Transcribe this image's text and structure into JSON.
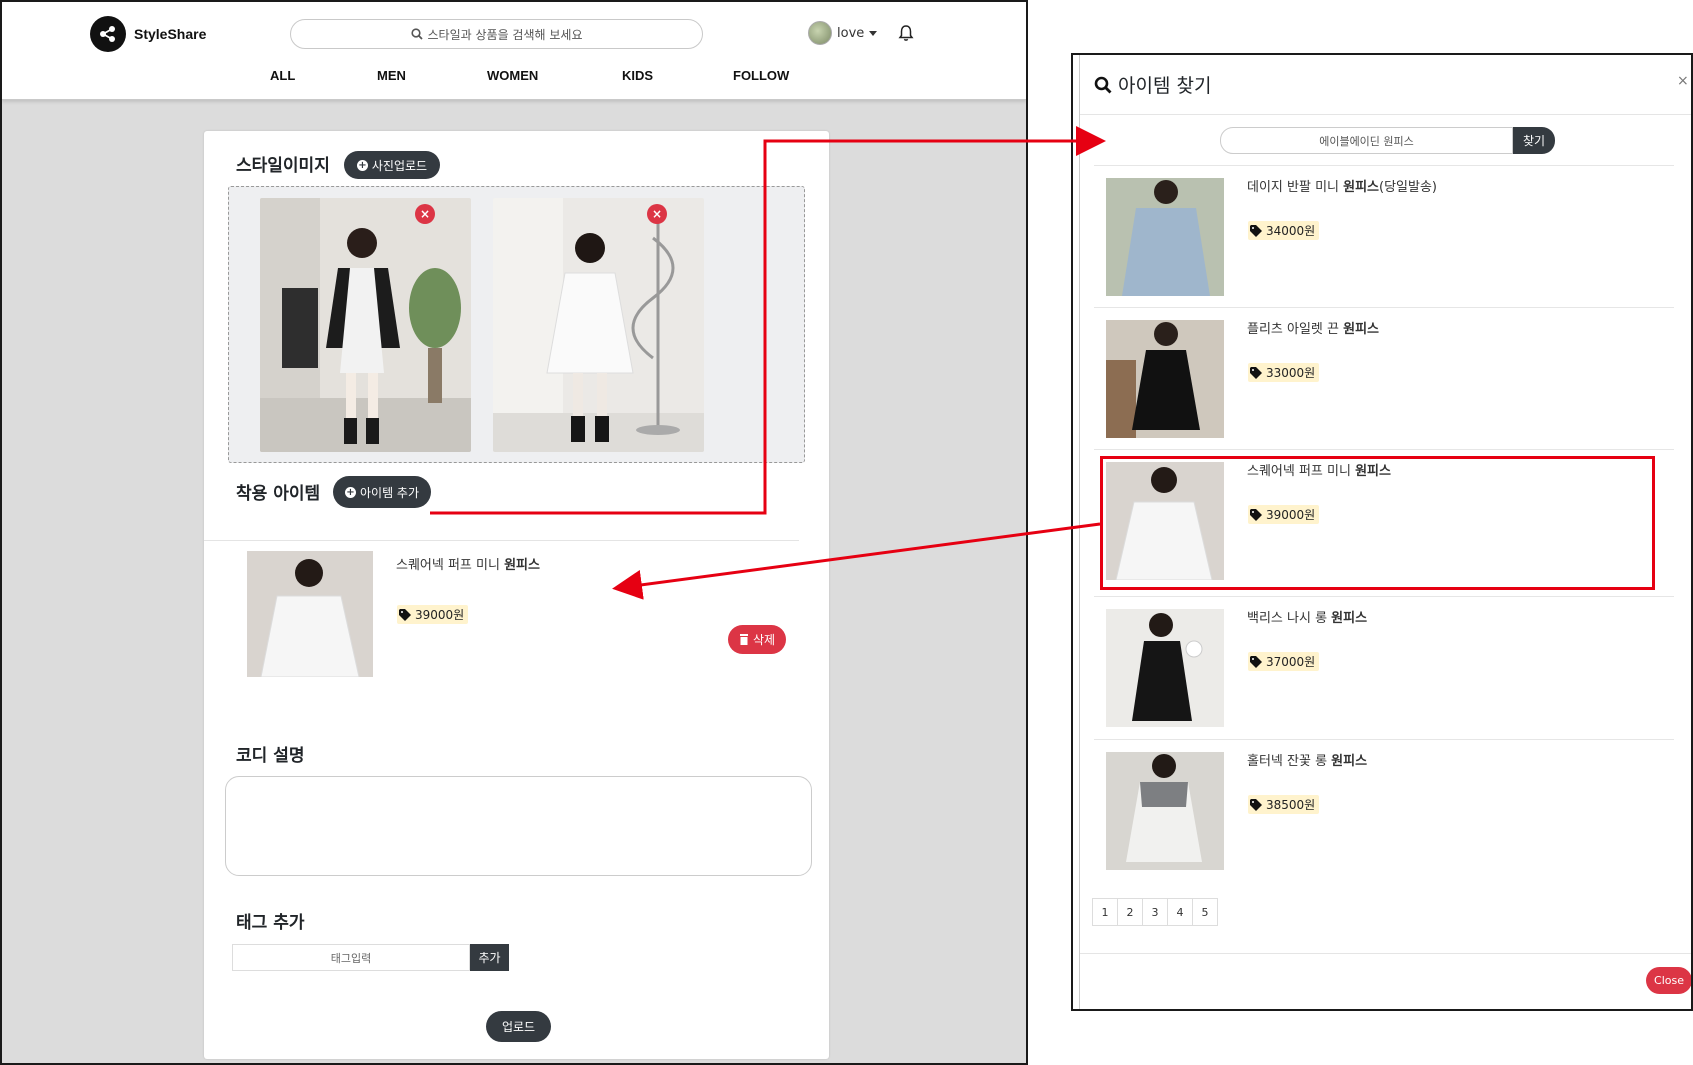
{
  "brand": {
    "name": "StyleShare",
    "logo_icon": "share-icon"
  },
  "search": {
    "placeholder": "스타일과 상품을 검색해 보세요",
    "icon": "search-icon"
  },
  "user": {
    "name": "love"
  },
  "nav": {
    "items": [
      "ALL",
      "MEN",
      "WOMEN",
      "KIDS",
      "FOLLOW"
    ]
  },
  "form": {
    "style_image": {
      "title": "스타일이미지",
      "upload_button": "사진업로드"
    },
    "worn_items": {
      "title": "착용 아이템",
      "add_button": "아이템 추가",
      "item": {
        "name_prefix": "스퀘어넥 퍼프 미니 ",
        "name_bold": "원피스",
        "price": "39000원"
      },
      "delete_button": "삭제"
    },
    "description": {
      "title": "코디 설명"
    },
    "tags": {
      "title": "태그 추가",
      "placeholder": "태그입력",
      "add_button": "추가"
    },
    "upload_button": "업로드"
  },
  "modal": {
    "title": "아이템 찾기",
    "search_value": "에이블에이딘 원피스",
    "search_button": "찾기",
    "close_button": "Close",
    "results": [
      {
        "name_prefix": "데이지 반팔 미니 ",
        "name_bold": "원피스",
        "name_suffix": "(당일발송)",
        "price": "34000원"
      },
      {
        "name_prefix": "플리츠 아일렛 끈 ",
        "name_bold": "원피스",
        "name_suffix": "",
        "price": "33000원"
      },
      {
        "name_prefix": "스퀘어넥 퍼프 미니 ",
        "name_bold": "원피스",
        "name_suffix": "",
        "price": "39000원"
      },
      {
        "name_prefix": "백리스 나시 롱 ",
        "name_bold": "원피스",
        "name_suffix": "",
        "price": "37000원"
      },
      {
        "name_prefix": "홀터넥 잔꽃 롱 ",
        "name_bold": "원피스",
        "name_suffix": "",
        "price": "38500원"
      }
    ],
    "pages": [
      "1",
      "2",
      "3",
      "4",
      "5"
    ]
  },
  "colors": {
    "accent_dark": "#343a40",
    "danger": "#dc3545",
    "annotation_red": "#e60012",
    "price_bg": "#fff3cd"
  }
}
